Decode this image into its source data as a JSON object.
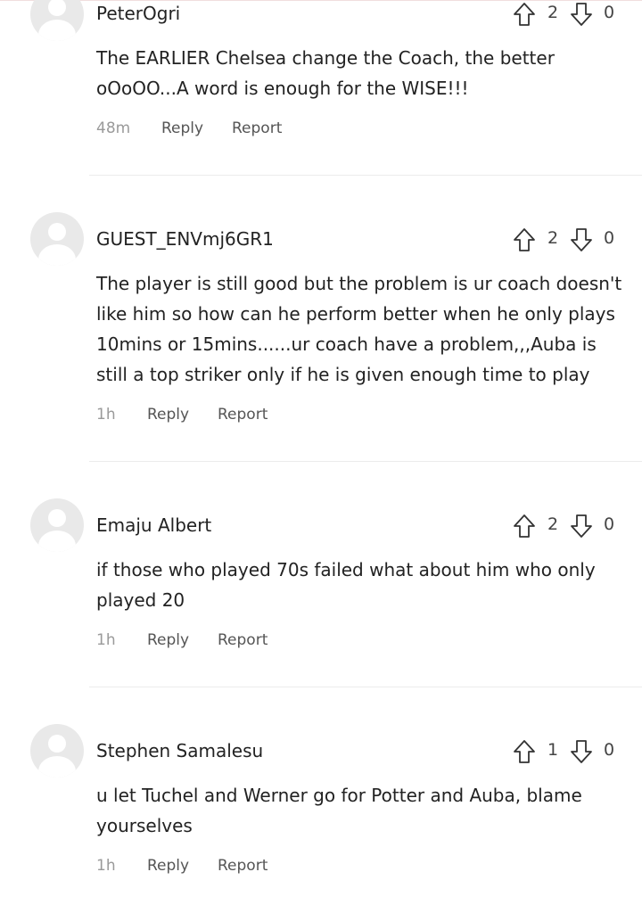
{
  "comments": [
    {
      "username": "PeterOgri",
      "text": "The EARLIER Chelsea change the Coach, the better oOoOO...A word is enough for the WISE!!!",
      "time": "48m",
      "upvotes": "2",
      "downvotes": "0",
      "reply_label": "Reply",
      "report_label": "Report"
    },
    {
      "username": "GUEST_ENVmj6GR1",
      "text": "The player is still good but the problem is ur coach doesn't like him so how can he perform better when he only plays 10mins or 15mins......ur coach have a problem,,,Auba is still a top striker only if he is given enough time to play",
      "time": "1h",
      "upvotes": "2",
      "downvotes": "0",
      "reply_label": "Reply",
      "report_label": "Report"
    },
    {
      "username": "Emaju Albert",
      "text": "if those who played 70s failed what about him who only played 20",
      "time": "1h",
      "upvotes": "2",
      "downvotes": "0",
      "reply_label": "Reply",
      "report_label": "Report"
    },
    {
      "username": "Stephen Samalesu",
      "text": "u let Tuchel and Werner go for Potter and Auba, blame yourselves",
      "time": "1h",
      "upvotes": "1",
      "downvotes": "0",
      "reply_label": "Reply",
      "report_label": "Report"
    }
  ]
}
